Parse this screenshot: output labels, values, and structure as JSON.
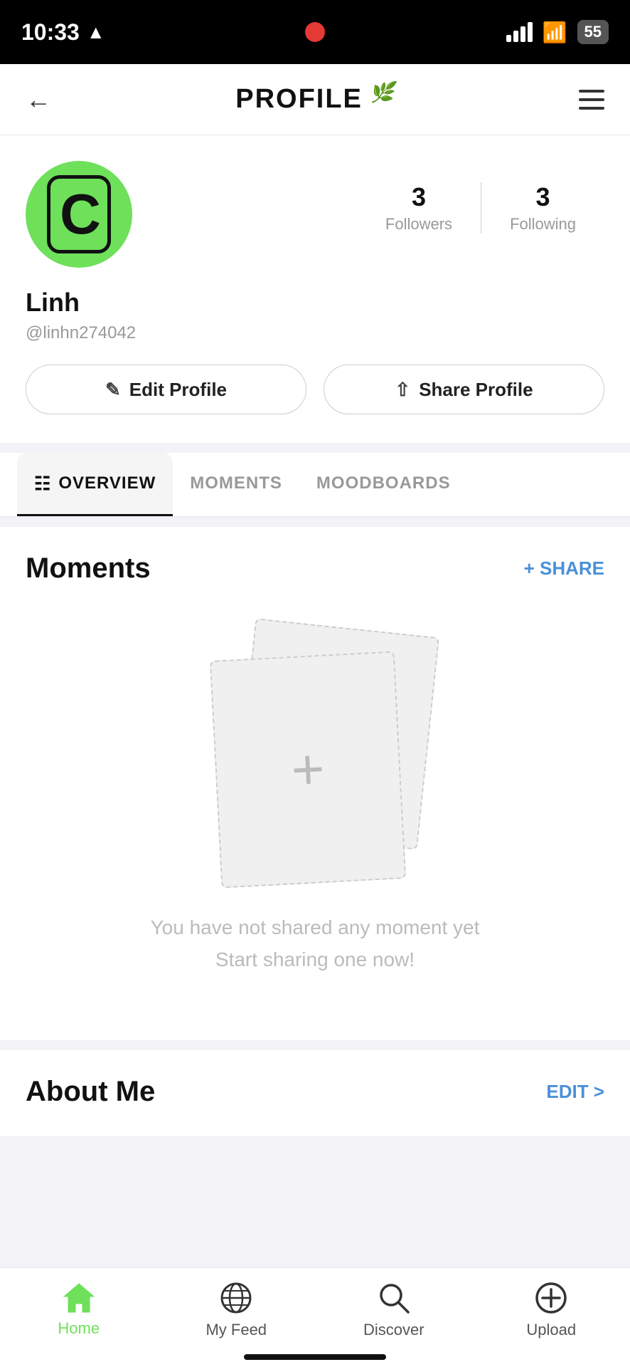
{
  "statusBar": {
    "time": "10:33",
    "battery": "55"
  },
  "header": {
    "title": "PROFILE",
    "backLabel": "←",
    "menuLabel": "☰"
  },
  "profile": {
    "name": "Linh",
    "handle": "@linhn274042",
    "followersCount": "3",
    "followersLabel": "Followers",
    "followingCount": "3",
    "followingLabel": "Following",
    "editButton": "Edit Profile",
    "shareButton": "Share Profile"
  },
  "tabs": [
    {
      "label": "OVERVIEW",
      "active": true
    },
    {
      "label": "MOMENTS",
      "active": false
    },
    {
      "label": "MOODBOARDS",
      "active": false
    }
  ],
  "moments": {
    "title": "Moments",
    "shareAction": "+ SHARE",
    "emptyLine1": "You have not shared any moment yet",
    "emptyLine2": "Start sharing one now!"
  },
  "aboutMe": {
    "title": "About Me",
    "editAction": "EDIT >"
  },
  "bottomNav": [
    {
      "label": "Home",
      "active": true,
      "icon": "home"
    },
    {
      "label": "My Feed",
      "active": false,
      "icon": "globe"
    },
    {
      "label": "Discover",
      "active": false,
      "icon": "search"
    },
    {
      "label": "Upload",
      "active": false,
      "icon": "plus-circle"
    }
  ]
}
